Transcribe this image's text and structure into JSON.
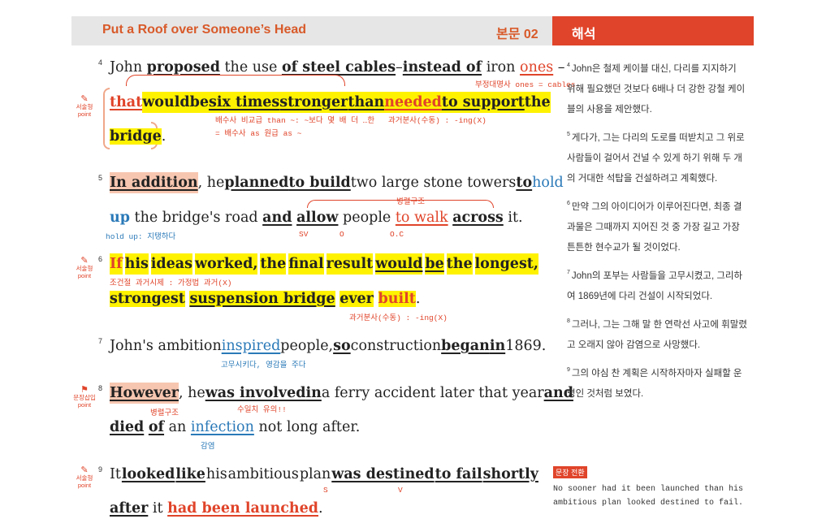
{
  "header": {
    "title": "Put a Roof over Someone’s Head",
    "section": "본문 02",
    "translation_tab": "해석"
  },
  "points": {
    "writing": "서술형",
    "point": "point",
    "insertion": "문장삽입"
  },
  "passage": {
    "s4": {
      "num": "4",
      "l1": [
        "John",
        "proposed",
        "the use",
        "of steel cables",
        "–",
        "instead of",
        "iron",
        "ones",
        "–"
      ],
      "l2": [
        "that",
        "would",
        "be",
        "six times",
        "stronger",
        "than",
        "needed",
        "to support",
        "the"
      ],
      "l3": [
        "bridge",
        "."
      ]
    },
    "s5": {
      "num": "5",
      "l1": [
        "In addition",
        ", he",
        "planned",
        "to build",
        "two large stone towers",
        "to",
        "hold"
      ],
      "l2": [
        "up",
        "the bridge's road",
        "and",
        "allow",
        "people",
        "to walk",
        "across",
        "it."
      ]
    },
    "s6": {
      "num": "6",
      "l1": [
        "If",
        "his",
        "ideas",
        "worked,",
        "the",
        "final",
        "result",
        "would",
        "be",
        "the",
        "longest,"
      ],
      "l2": [
        "strongest",
        "suspension bridge",
        "ever",
        "built",
        "."
      ]
    },
    "s7": {
      "num": "7",
      "l1": [
        "John's ambition",
        "inspired",
        "people,",
        "so",
        "construction",
        "began",
        "in",
        "1869."
      ]
    },
    "s8": {
      "num": "8",
      "l1": [
        "However",
        ", he",
        "was involved",
        "in",
        "a ferry accident later that year",
        "and"
      ],
      "l2": [
        "died",
        "of",
        "an",
        "infection",
        "not long after."
      ]
    },
    "s9": {
      "num": "9",
      "l1": [
        "It",
        "looked",
        "like",
        "his",
        "ambitious",
        "plan",
        "was destined",
        "to fail",
        "shortly"
      ],
      "l2": [
        "after",
        "it",
        "had been launched",
        "."
      ]
    }
  },
  "notes": {
    "pronoun": "부정대명사 ones = cables",
    "comparison": "배수사 비교급 than ~: ~보다 몇 배 더 …한",
    "comparison2": "= 배수사 as 원급 as ~",
    "pp1": "과거분사(수동) : -ing(X)",
    "hold_up": "hold up: 지탱하다",
    "parallel": "병렬구조",
    "sv": "SV",
    "o": "O",
    "oc": "O.C",
    "conditional": "조건절 과거시제 : 가정법 과거(X)",
    "pp2": "과거분사(수동) : -ing(X)",
    "inspire": "고무시키다, 영감을 주다",
    "parallel2": "병렬구조",
    "agreement": "수일치 유의!!",
    "infection": "감염",
    "s": "S",
    "v": "V"
  },
  "translation": [
    {
      "num": "4",
      "text": "John은 철제 케이블 대신, 다리를 지지하기 위해 필요했던 것보다 6배나 더 강한 강철 케이블의 사용을 제안했다."
    },
    {
      "num": "5",
      "text": "게다가, 그는 다리의 도로를 떠받치고 그 위로 사람들이 걸어서 건널 수 있게 하기 위해 두 개의 거대한 석탑을 건설하려고 계획했다."
    },
    {
      "num": "6",
      "text": "만약 그의 아이디어가 이루어진다면, 최종 결과물은 그때까지 지어진 것 중 가장 길고 가장 튼튼한 현수교가 될 것이었다."
    },
    {
      "num": "7",
      "text": "John의 포부는 사람들을 고무시켰고, 그리하여 1869년에 다리 건설이 시작되었다."
    },
    {
      "num": "8",
      "text": "그러나, 그는 그해 말 한 연락선 사고에 휘말렸고 오래지 않아 감염으로 사망했다."
    },
    {
      "num": "9",
      "text": "그의 야심 찬 계획은 시작하자마자 실패할 운명인 것처럼 보였다."
    }
  ],
  "conversion": {
    "badge": "문장 전환",
    "text": "No sooner had it been launched than his ambitious plan looked destined to fail."
  }
}
